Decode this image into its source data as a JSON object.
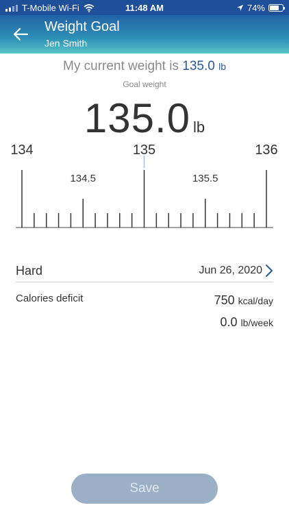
{
  "status_bar": {
    "carrier": "T-Mobile Wi-Fi",
    "time": "11:48 AM",
    "battery_percent": "74%",
    "battery_level": 0.74
  },
  "header": {
    "title": "Weight Goal",
    "subtitle": "Jen Smith",
    "back_icon": "arrow-left-icon"
  },
  "current_weight": {
    "prefix": "My current weight is",
    "value": "135.0",
    "unit": "lb"
  },
  "goal": {
    "label": "Goal weight",
    "value": "135.0",
    "unit": "lb"
  },
  "ruler": {
    "labels": [
      {
        "value": 134,
        "text": "134"
      },
      {
        "value": 134.5,
        "text": "134.5"
      },
      {
        "value": 135,
        "text": "135"
      },
      {
        "value": 135.5,
        "text": "135.5"
      },
      {
        "value": 136,
        "text": "136"
      }
    ],
    "range": [
      134,
      136
    ],
    "step": 0.1,
    "selected": 135.0
  },
  "plan": {
    "difficulty": "Hard",
    "date": "Jun 26, 2020",
    "chevron_icon": "chevron-right-icon",
    "calories_label": "Calories deficit",
    "calories_value": "750",
    "calories_unit": "kcal/day",
    "rate_value": "0.0",
    "rate_unit": "lb/week"
  },
  "save_label": "Save",
  "colors": {
    "accent": "#2a5a98",
    "save_disabled": "#9bb0c6"
  }
}
